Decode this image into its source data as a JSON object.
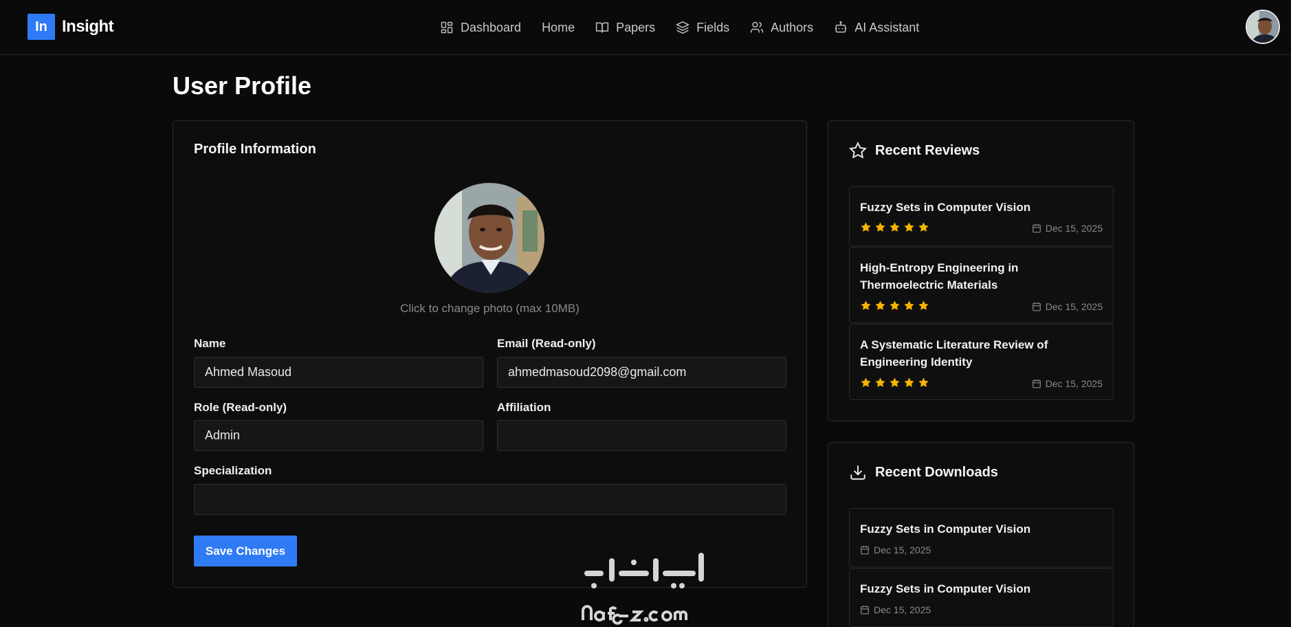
{
  "brand": {
    "mark": "In",
    "name": "Insight"
  },
  "nav": [
    {
      "label": "Dashboard",
      "icon": "grid-icon"
    },
    {
      "label": "Home",
      "icon": ""
    },
    {
      "label": "Papers",
      "icon": "book-open-icon"
    },
    {
      "label": "Fields",
      "icon": "layers-icon"
    },
    {
      "label": "Authors",
      "icon": "users-icon"
    },
    {
      "label": "AI Assistant",
      "icon": "bot-icon"
    }
  ],
  "page": {
    "title": "User Profile"
  },
  "profile": {
    "title": "Profile Information",
    "photo_hint": "Click to change photo (max 10MB)",
    "name_label": "Name",
    "name_value": "Ahmed Masoud",
    "email_label": "Email (Read-only)",
    "email_value": "ahmedmasoud2098@gmail.com",
    "role_label": "Role (Read-only)",
    "role_value": "Admin",
    "affiliation_label": "Affiliation",
    "affiliation_value": "",
    "specialization_label": "Specialization",
    "specialization_value": "",
    "save_label": "Save Changes"
  },
  "reviews": {
    "title": "Recent Reviews",
    "items": [
      {
        "title": "Fuzzy Sets in Computer Vision",
        "rating": 5,
        "date": "Dec 15, 2025"
      },
      {
        "title": "High-Entropy Engineering in Thermoelectric Materials",
        "rating": 5,
        "date": "Dec 15, 2025"
      },
      {
        "title": "A Systematic Literature Review of Engineering Identity",
        "rating": 5,
        "date": "Dec 15, 2025"
      }
    ]
  },
  "downloads": {
    "title": "Recent Downloads",
    "items": [
      {
        "title": "Fuzzy Sets in Computer Vision",
        "date": "Dec 15, 2025"
      },
      {
        "title": "Fuzzy Sets in Computer Vision",
        "date": "Dec 15, 2025"
      }
    ]
  },
  "colors": {
    "accent": "#2f7bf6",
    "star": "#f5b400",
    "background": "#0a0a0a"
  }
}
